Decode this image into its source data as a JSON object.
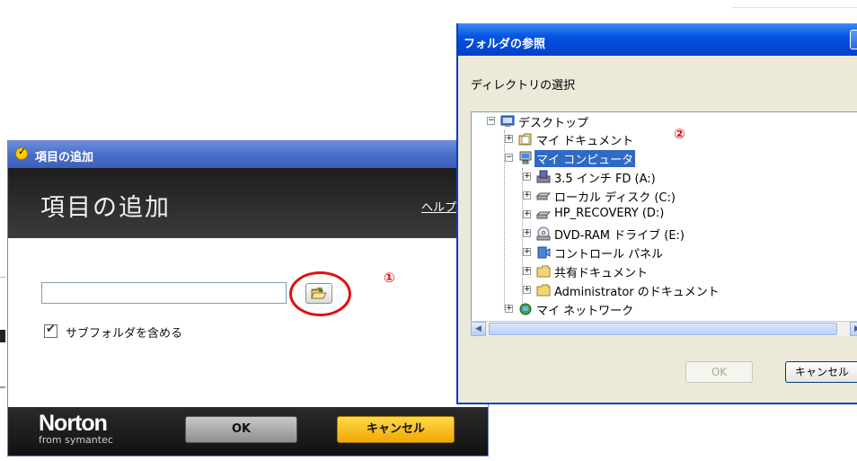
{
  "norton_dialog": {
    "window_title": "項目の追加",
    "header_title": "項目の追加",
    "help_link": "ヘルプ",
    "path_input": {
      "value": "",
      "placeholder": ""
    },
    "include_subfolders": {
      "label": "サブフォルダを含める",
      "checked": true
    },
    "annotation": "①",
    "logo": {
      "main": "Norton",
      "sub": "from symantec"
    },
    "ok_label": "OK",
    "cancel_label": "キャンセル",
    "colors": {
      "header_bg": "#2a2a2a",
      "cancel_bg": "#f5b800",
      "annotation": "#e01010"
    }
  },
  "browse_dialog": {
    "window_title": "フォルダの参照",
    "description": "ディレクトリの選択",
    "annotation": "②",
    "tree": {
      "root": {
        "label": "デスクトップ",
        "icon": "desktop-icon"
      },
      "items": [
        {
          "label": "マイ ドキュメント",
          "icon": "my-documents-icon",
          "level": 1
        },
        {
          "label": "マイ コンピュータ",
          "icon": "my-computer-icon",
          "level": 1,
          "selected": true
        },
        {
          "label": "3.5 インチ FD (A:)",
          "icon": "floppy-drive-icon",
          "level": 2
        },
        {
          "label": "ローカル ディスク (C:)",
          "icon": "hard-disk-icon",
          "level": 2
        },
        {
          "label": "HP_RECOVERY (D:)",
          "icon": "hard-disk-icon",
          "level": 2
        },
        {
          "label": "DVD-RAM ドライブ (E:)",
          "icon": "dvd-drive-icon",
          "level": 2
        },
        {
          "label": "コントロール パネル",
          "icon": "control-panel-icon",
          "level": 2
        },
        {
          "label": "共有ドキュメント",
          "icon": "folder-icon",
          "level": 2
        },
        {
          "label": "Administrator のドキュメント",
          "icon": "folder-icon",
          "level": 2
        },
        {
          "label": "マイ ネットワーク",
          "icon": "network-icon",
          "level": 1
        }
      ]
    },
    "ok_label": "OK",
    "cancel_label": "キャンセル",
    "colors": {
      "title_bar": "#0554e3",
      "selection": "#316ac5"
    }
  }
}
